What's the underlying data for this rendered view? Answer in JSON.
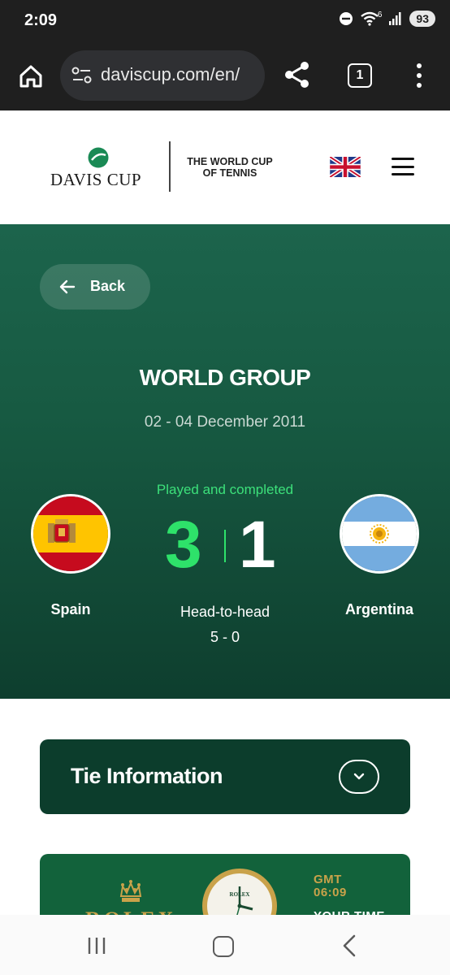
{
  "status_bar": {
    "time": "2:09",
    "battery": "93",
    "network_badge": "6"
  },
  "browser": {
    "url": "daviscup.com/en/",
    "tab_count": "1"
  },
  "site_header": {
    "logo_text": "DAVIS CUP",
    "tagline_line1": "THE WORLD CUP",
    "tagline_line2": "OF TENNIS"
  },
  "hero": {
    "back_label": "Back",
    "group_title": "WORLD GROUP",
    "date_range": "02 - 04 December 2011",
    "status": "Played and completed",
    "home_team": "Spain",
    "away_team": "Argentina",
    "home_score": "3",
    "away_score": "1",
    "h2h_label": "Head-to-head",
    "h2h_value": "5 - 0"
  },
  "tie_info": {
    "title": "Tie Information"
  },
  "ad": {
    "brand": "ROLEX",
    "watch_brand": "ROLEX",
    "gmt_label": "GMT",
    "gmt_time": "06:09",
    "your_time": "YOUR TIME"
  },
  "colors": {
    "hero_green": "#175a42",
    "score_green": "#2ee26a",
    "card_green": "#0c3d2c",
    "rolex_green": "#12623b",
    "gold": "#c9a24a"
  }
}
